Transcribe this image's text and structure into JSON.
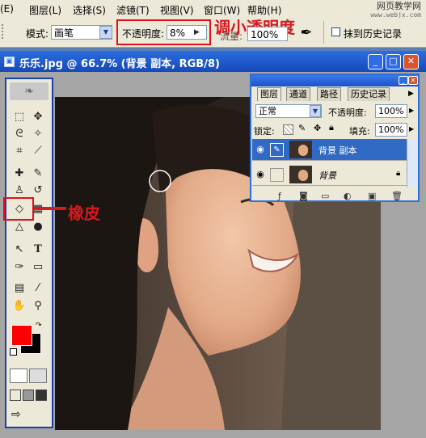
{
  "menubar": {
    "items": [
      "图层(L)",
      "选择(S)",
      "滤镜(T)",
      "视图(V)",
      "窗口(W)",
      "帮助(H)"
    ],
    "partial_left": "(E)",
    "watermark_title": "网页教学网",
    "watermark_url": "www.webjx.com"
  },
  "options": {
    "mode_label": "模式:",
    "mode_value": "画笔",
    "opacity_label": "不透明度:",
    "opacity_value": "8%",
    "flow_label": "流量:",
    "flow_value": "100%",
    "erase_history_label": "抹到历史记录",
    "annotation": "调小透明度"
  },
  "document": {
    "title": "乐乐.jpg @ 66.7% (背景 副本, RGB/8)"
  },
  "toolbox": {
    "annotation": "橡皮",
    "foreground_color": "#ff0000",
    "background_color": "#000000"
  },
  "layers_panel": {
    "tabs": [
      "图层",
      "通道",
      "路径",
      "历史记录"
    ],
    "blend_mode": "正常",
    "opacity_label": "不透明度:",
    "opacity_value": "100%",
    "lock_label": "锁定:",
    "fill_label": "填充:",
    "fill_value": "100%",
    "layers": [
      {
        "name": "背景 副本",
        "selected": true
      },
      {
        "name": "背景",
        "selected": false
      }
    ]
  },
  "colors": {
    "xp_blue": "#2a6ee0",
    "annotation_red": "#d71920",
    "selection_blue": "#316ac5"
  }
}
